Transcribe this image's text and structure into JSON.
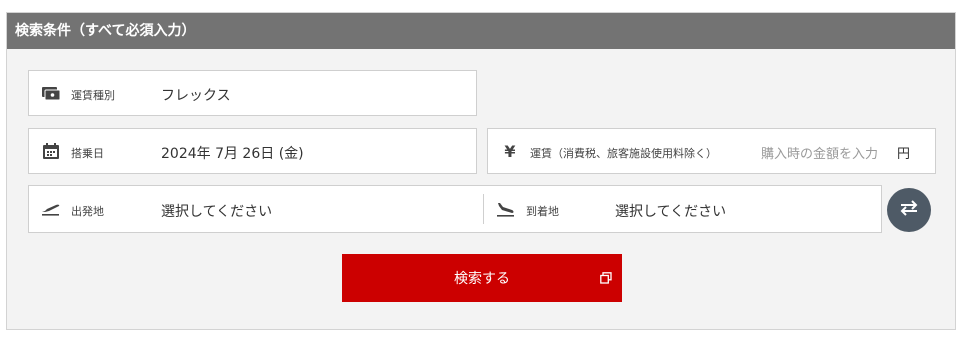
{
  "header": {
    "title": "検索条件（すべて必須入力）"
  },
  "fare_type": {
    "label": "運賃種別",
    "value": "フレックス",
    "icon": "ticket-icon"
  },
  "boarding_date": {
    "label": "搭乗日",
    "value": "2024年 7月 26日 (金)",
    "icon": "calendar-icon"
  },
  "fare_amount": {
    "icon_glyph": "¥",
    "label": "運賃（消費税、旅客施設使用料除く）",
    "placeholder": "購入時の金額を入力",
    "unit": "円"
  },
  "departure": {
    "label": "出発地",
    "value": "選択してください",
    "icon": "takeoff-icon"
  },
  "arrival": {
    "label": "到着地",
    "value": "選択してください",
    "icon": "landing-icon"
  },
  "swap": {
    "icon": "swap-arrows-icon"
  },
  "search_button": {
    "label": "検索する",
    "icon": "external-window-icon"
  },
  "colors": {
    "header_bg": "#737373",
    "button_red": "#cc0000",
    "swap_bg": "#4e5a66"
  }
}
